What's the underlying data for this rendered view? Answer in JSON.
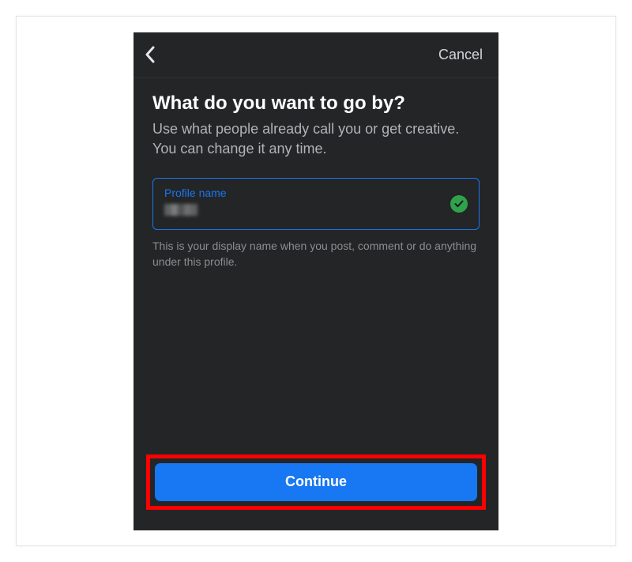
{
  "header": {
    "cancel_label": "Cancel"
  },
  "content": {
    "title": "What do you want to go by?",
    "subtitle": "Use what people already call you or get creative. You can change it any time.",
    "input_label": "Profile name",
    "helper_text": "This is your display name when you post, comment or do anything under this profile."
  },
  "footer": {
    "continue_label": "Continue"
  },
  "colors": {
    "accent": "#1877f2",
    "success": "#31a24c",
    "highlight": "#ff0000",
    "background": "#242526"
  }
}
